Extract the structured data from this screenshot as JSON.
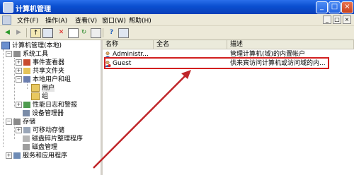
{
  "window": {
    "title": "计算机管理",
    "buttons": [
      "_",
      "□",
      "×"
    ]
  },
  "menubar": {
    "items": [
      "文件(F)",
      "操作(A)",
      "查看(V)",
      "窗口(W)",
      "帮助(H)"
    ],
    "right_buttons": [
      "_",
      "□",
      "×"
    ]
  },
  "tree": {
    "root": "计算机管理(本地)",
    "items": [
      {
        "label": "系统工具"
      },
      {
        "label": "事件查看器"
      },
      {
        "label": "共享文件夹"
      },
      {
        "label": "本地用户和组"
      },
      {
        "label": "用户"
      },
      {
        "label": "组"
      },
      {
        "label": "性能日志和警报"
      },
      {
        "label": "设备管理器"
      },
      {
        "label": "存储"
      },
      {
        "label": "可移动存储"
      },
      {
        "label": "磁盘碎片整理程序"
      },
      {
        "label": "磁盘管理"
      },
      {
        "label": "服务和应用程序"
      }
    ]
  },
  "list": {
    "columns": [
      "名称",
      "全名",
      "描述"
    ],
    "rows": [
      {
        "name": "Administr...",
        "fullname": "",
        "description": "管理计算机(域)的内置帐户"
      },
      {
        "name": "Guest",
        "fullname": "",
        "description": "供来宾访问计算机或访问域的内..."
      }
    ]
  },
  "colors": {
    "titlebar": "#0a4fd0",
    "highlight_box": "#d21f1f",
    "arrow": "#c0262a"
  }
}
